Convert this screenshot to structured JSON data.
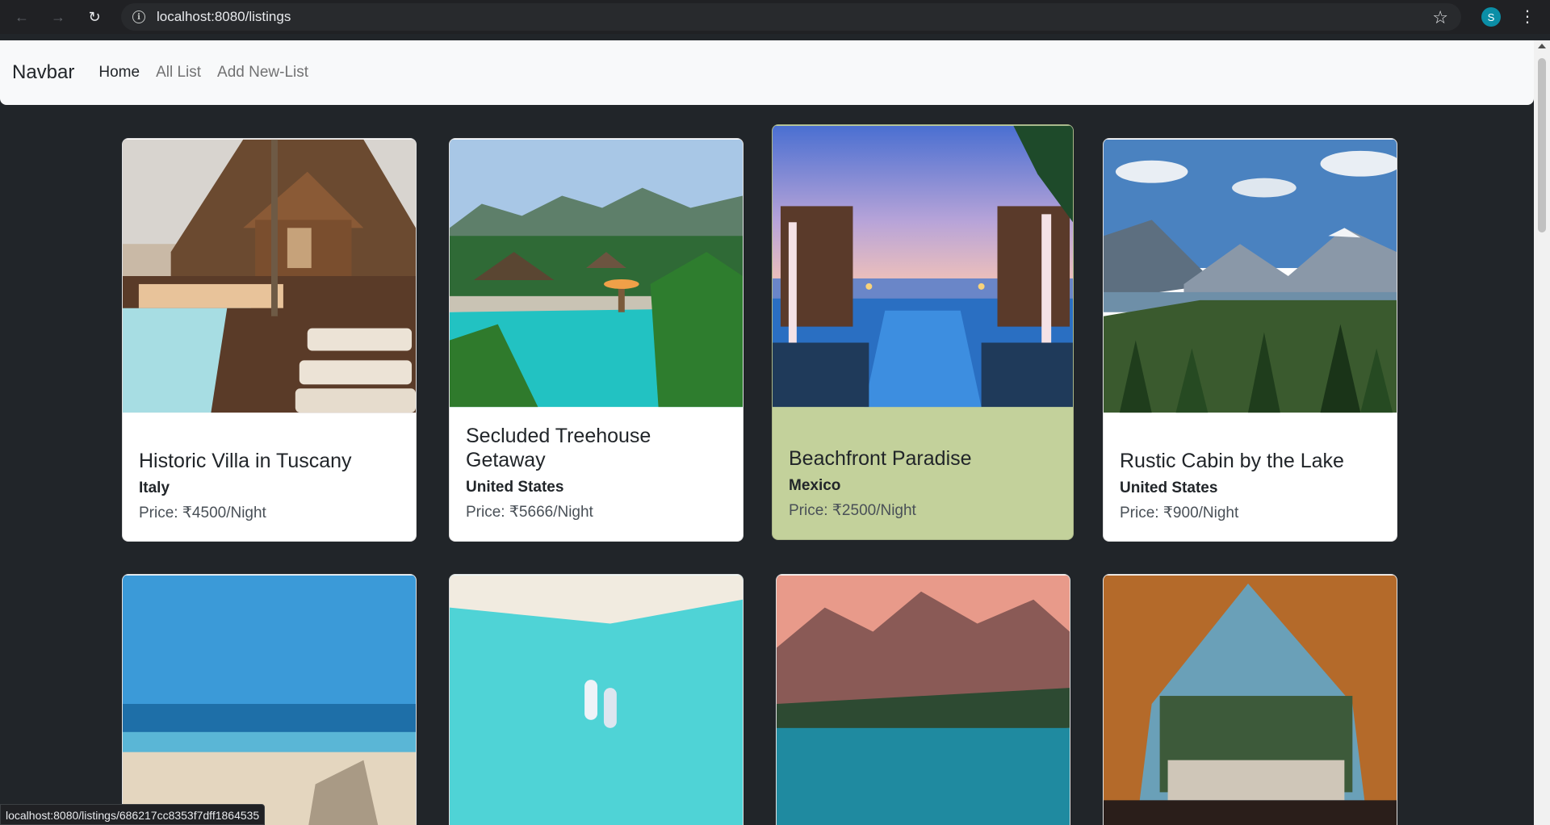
{
  "browser": {
    "url": "localhost:8080/listings",
    "profile_initial": "S",
    "status_url": "localhost:8080/listings/686217cc8353f7dff1864535"
  },
  "navbar": {
    "brand": "Navbar",
    "links": [
      "Home",
      "All List",
      "Add New-List"
    ]
  },
  "listings": [
    {
      "title": "Historic Villa in Tuscany",
      "country": "Italy",
      "price": "Price: ₹4500/Night"
    },
    {
      "title": "Secluded Treehouse Getaway",
      "country": "United States",
      "price": "Price: ₹5666/Night"
    },
    {
      "title": "Beachfront Paradise",
      "country": "Mexico",
      "price": "Price: ₹2500/Night"
    },
    {
      "title": "Rustic Cabin by the Lake",
      "country": "United States",
      "price": "Price: ₹900/Night"
    }
  ],
  "colors": {
    "page_bg": "#212529",
    "navbar_bg": "#f8f9fa",
    "hover_card_bg": "#c3d19b"
  }
}
